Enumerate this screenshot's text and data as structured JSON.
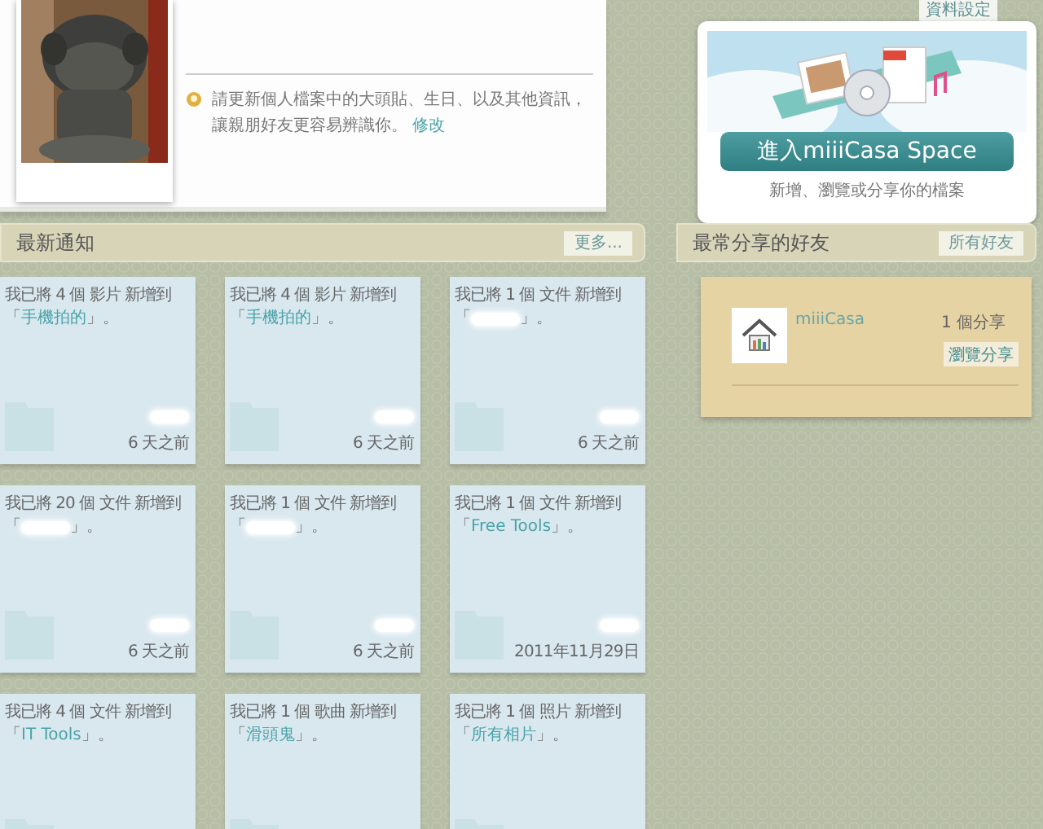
{
  "settings_tab": {
    "label": "資料設定"
  },
  "profile": {
    "notice": "請更新個人檔案中的大頭貼、生日、以及其他資訊，讓親朋好友更容易辨識你。",
    "edit_link": "修改"
  },
  "promo": {
    "button": "進入miiiCasa Space",
    "caption": "新增、瀏覽或分享你的檔案"
  },
  "notifications": {
    "title": "最新通知",
    "more": "更多...",
    "items": [
      {
        "text": "我已將 4 個 影片 新增到",
        "prefix": "「",
        "folder": "手機拍的",
        "suffix": "」。",
        "sender_redacted": true,
        "time": "6 天之前"
      },
      {
        "text": "我已將 4 個 影片 新增到",
        "prefix": "「",
        "folder": "手機拍的",
        "suffix": "」。",
        "sender_redacted": true,
        "time": "6 天之前"
      },
      {
        "text": "我已將 1 個 文件 新增到",
        "prefix": "「",
        "folder_redacted": true,
        "suffix": "」。",
        "sender_redacted": true,
        "time": "6 天之前"
      },
      {
        "text": "我已將 20 個 文件 新增到",
        "prefix": "「",
        "folder_redacted": true,
        "suffix": "」。",
        "sender_redacted": true,
        "time": "6 天之前"
      },
      {
        "text": "我已將 1 個 文件 新增到",
        "prefix": "「",
        "folder_redacted": true,
        "suffix": "」。",
        "sender_redacted": true,
        "time": "6 天之前"
      },
      {
        "text": "我已將 1 個 文件 新增到",
        "prefix": "「",
        "folder": "Free Tools",
        "suffix": "」。",
        "sender_redacted": true,
        "time": "2011年11月29日"
      },
      {
        "text": "我已將 4 個 文件 新增到",
        "prefix": "「",
        "folder": "IT Tools",
        "suffix": "」。"
      },
      {
        "text": "我已將 1 個 歌曲 新增到",
        "prefix": "「",
        "folder": "滑頭鬼",
        "suffix": "」。"
      },
      {
        "text": "我已將 1 個 照片 新增到",
        "prefix": "「",
        "folder": "所有相片",
        "suffix": "」。"
      }
    ]
  },
  "friends": {
    "title": "最常分享的好友",
    "all_button": "所有好友",
    "items": [
      {
        "name": "miiiCasa",
        "count": "1 個分享",
        "action": "瀏覽分享"
      }
    ]
  }
}
